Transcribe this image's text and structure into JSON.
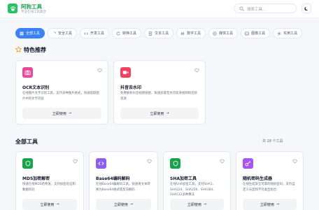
{
  "brand": {
    "name": "阿狗工具",
    "subtitle": "专业在线工具集合"
  },
  "search": {
    "placeholder": "搜索工具..."
  },
  "tabs": [
    {
      "label": "全部工具",
      "icon": "grid-icon",
      "active": true
    },
    {
      "label": "安全工具",
      "icon": "shield-icon",
      "active": false
    },
    {
      "label": "开发工具",
      "icon": "code-icon",
      "active": false
    },
    {
      "label": "转换工具",
      "icon": "refresh-icon",
      "active": false
    },
    {
      "label": "文本工具",
      "icon": "document-icon",
      "active": false
    },
    {
      "label": "数字工具",
      "icon": "hash-icon",
      "active": false
    },
    {
      "label": "媒体工具",
      "icon": "play-icon",
      "active": false
    },
    {
      "label": "图像工具",
      "icon": "image-icon",
      "active": false
    },
    {
      "label": "实用工具",
      "icon": "tool-icon",
      "active": false
    }
  ],
  "featured": {
    "title": "特色推荐",
    "cards": [
      {
        "title": "OCR文本识别",
        "desc": "在线图片文字识别工具，支持多种图片格式，快速提取图片中的文字内容",
        "button": "立即使用",
        "icon": "camera-icon",
        "color": "#ec4899"
      },
      {
        "title": "抖音去水印",
        "desc": "免费解析抖音视频链接，快速获取无水印高清视频和音频资源",
        "button": "立即使用",
        "icon": "video-icon",
        "color": "#f43f5e"
      }
    ]
  },
  "all_tools": {
    "title": "全部工具",
    "count": "共 28 个工具",
    "cards": [
      {
        "title": "MD5加密解密",
        "desc": "快速在线MD5哈希值，支持加密验证和数据校验",
        "button": "立即使用",
        "icon": "shield-icon",
        "color": "#16a34a"
      },
      {
        "title": "Base64编码解码",
        "desc": "在线Base64编解码工具，快速将文本转换为Base64格式或反向解码",
        "button": "立即使用",
        "icon": "code-icon",
        "color": "#8b5cf6"
      },
      {
        "title": "SHA加密工具",
        "desc": "在线SHA加密工具，支持SHA1、SHA224、SHA256、SHA384、SHA512多种算法",
        "button": "立即使用",
        "icon": "shield-icon",
        "color": "#16a34a"
      },
      {
        "title": "随机密码生成器",
        "desc": "在线生成安全可靠的随机密码，支持自定义长度和字符类型组合",
        "button": "立即使用",
        "icon": "key-icon",
        "color": "#a855f7"
      }
    ]
  }
}
